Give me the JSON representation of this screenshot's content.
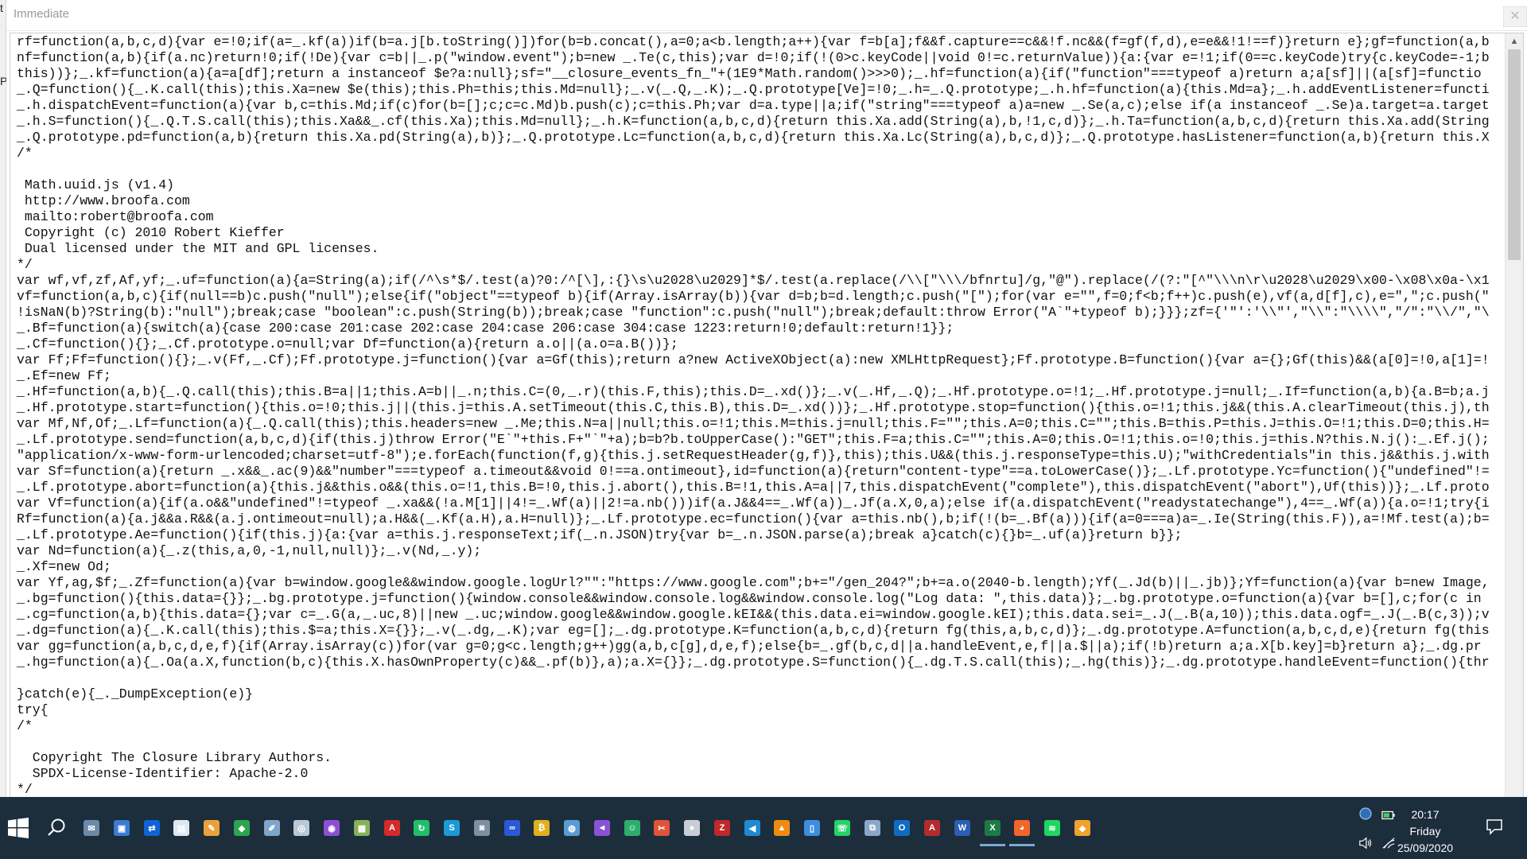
{
  "window": {
    "title": "Immediate",
    "close_glyph": "✕"
  },
  "left_sliver": {
    "glyphs": [
      "t",
      "P"
    ]
  },
  "code_lines": [
    "rf=function(a,b,c,d){var e=!0;if(a=_.kf(a))if(b=a.j[b.toString()])for(b=b.concat(),a=0;a<b.length;a++){var f=b[a];f&&f.capture==c&&!f.nc&&(f=gf(f,d),e=e&&!1!==f)}return e};gf=function(a,b",
    "nf=function(a,b){if(a.nc)return!0;if(!De){var c=b||_.p(\"window.event\");b=new _.Te(c,this);var d=!0;if(!(0>c.keyCode||void 0!=c.returnValue)){a:{var e=!1;if(0==c.keyCode)try{c.keyCode=-1;b",
    "this))};_.kf=function(a){a=a[df];return a instanceof $e?a:null};sf=\"__closure_events_fn_\"+(1E9*Math.random()>>>0);_.hf=function(a){if(\"function\"===typeof a)return a;a[sf]||(a[sf]=functio",
    "_.Q=function(){_.K.call(this);this.Xa=new $e(this);this.Ph=this;this.Md=null};_.v(_.Q,_.K);_.Q.prototype[Ve]=!0;_.h=_.Q.prototype;_.h.hf=function(a){this.Md=a};_.h.addEventListener=functi",
    "_.h.dispatchEvent=function(a){var b,c=this.Md;if(c)for(b=[];c;c=c.Md)b.push(c);c=this.Ph;var d=a.type||a;if(\"string\"===typeof a)a=new _.Se(a,c);else if(a instanceof _.Se)a.target=a.target",
    "_.h.S=function(){_.Q.T.S.call(this);this.Xa&&_.cf(this.Xa);this.Md=null};_.h.K=function(a,b,c,d){return this.Xa.add(String(a),b,!1,c,d)};_.h.Ta=function(a,b,c,d){return this.Xa.add(String",
    "_.Q.prototype.pd=function(a,b){return this.Xa.pd(String(a),b)};_.Q.prototype.Lc=function(a,b,c,d){return this.Xa.Lc(String(a),b,c,d)};_.Q.prototype.hasListener=function(a,b){return this.X",
    "/*",
    "",
    " Math.uuid.js (v1.4)",
    " http://www.broofa.com",
    " mailto:robert@broofa.com",
    " Copyright (c) 2010 Robert Kieffer",
    " Dual licensed under the MIT and GPL licenses.",
    "*/",
    "var wf,vf,zf,Af,yf;_.uf=function(a){a=String(a);if(/^\\s*$/.test(a)?0:/^[\\],:{}\\s\\u2028\\u2029]*$/.test(a.replace(/\\\\[\"\\\\\\/bfnrtu]/g,\"@\").replace(/(?:\"[^\"\\\\\\n\\r\\u2028\\u2029\\x00-\\x08\\x0a-\\x1",
    "vf=function(a,b,c){if(null==b)c.push(\"null\");else{if(\"object\"==typeof b){if(Array.isArray(b)){var d=b;b=d.length;c.push(\"[\");for(var e=\"\",f=0;f<b;f++)c.push(e),vf(a,d[f],c),e=\",\";c.push(\"",
    "!isNaN(b)?String(b):\"null\");break;case \"boolean\":c.push(String(b));break;case \"function\":c.push(\"null\");break;default:throw Error(\"A`\"+typeof b);}}};zf={'\"':'\\\\\"',\"\\\\\":\"\\\\\\\\\",\"/\":\"\\\\/\",\"\\",
    "_.Bf=function(a){switch(a){case 200:case 201:case 202:case 204:case 206:case 304:case 1223:return!0;default:return!1}};",
    "_.Cf=function(){};_.Cf.prototype.o=null;var Df=function(a){return a.o||(a.o=a.B())};",
    "var Ff;Ff=function(){};_.v(Ff,_.Cf);Ff.prototype.j=function(){var a=Gf(this);return a?new ActiveXObject(a):new XMLHttpRequest};Ff.prototype.B=function(){var a={};Gf(this)&&(a[0]=!0,a[1]=!",
    "_.Ef=new Ff;",
    "_.Hf=function(a,b){_.Q.call(this);this.B=a||1;this.A=b||_.n;this.C=(0,_.r)(this.F,this);this.D=_.xd()};_.v(_.Hf,_.Q);_.Hf.prototype.o=!1;_.Hf.prototype.j=null;_.If=function(a,b){a.B=b;a.j",
    "_.Hf.prototype.start=function(){this.o=!0;this.j||(this.j=this.A.setTimeout(this.C,this.B),this.D=_.xd())};_.Hf.prototype.stop=function(){this.o=!1;this.j&&(this.A.clearTimeout(this.j),th",
    "var Mf,Nf,Of;_.Lf=function(a){_.Q.call(this);this.headers=new _.Me;this.N=a||null;this.o=!1;this.M=this.j=null;this.F=\"\";this.A=0;this.C=\"\";this.B=this.P=this.J=this.O=!1;this.D=0;this.H=",
    "_.Lf.prototype.send=function(a,b,c,d){if(this.j)throw Error(\"E`\"+this.F+\"`\"+a);b=b?b.toUpperCase():\"GET\";this.F=a;this.C=\"\";this.A=0;this.O=!1;this.o=!0;this.j=this.N?this.N.j():_.Ef.j();",
    "\"application/x-www-form-urlencoded;charset=utf-8\");e.forEach(function(f,g){this.j.setRequestHeader(g,f)},this);this.U&&(this.j.responseType=this.U);\"withCredentials\"in this.j&&this.j.with",
    "var Sf=function(a){return _.x&&_.ac(9)&&\"number\"===typeof a.timeout&&void 0!==a.ontimeout},id=function(a){return\"content-type\"==a.toLowerCase()};_.Lf.prototype.Yc=function(){\"undefined\"!=",
    "_.Lf.prototype.abort=function(a){this.j&&this.o&&(this.o=!1,this.B=!0,this.j.abort(),this.B=!1,this.A=a||7,this.dispatchEvent(\"complete\"),this.dispatchEvent(\"abort\"),Uf(this))};_.Lf.proto",
    "var Vf=function(a){if(a.o&&\"undefined\"!=typeof _.xa&&(!a.M[1]||4!=_.Wf(a)||2!=a.nb()))if(a.J&&4==_.Wf(a))_.Jf(a.X,0,a);else if(a.dispatchEvent(\"readystatechange\"),4==_.Wf(a)){a.o=!1;try{i",
    "Rf=function(a){a.j&&a.R&&(a.j.ontimeout=null);a.H&&(_.Kf(a.H),a.H=null)};_.Lf.prototype.ec=function(){var a=this.nb(),b;if(!(b=_.Bf(a))){if(a=0===a)a=_.Ie(String(this.F)),a=!Mf.test(a);b=",
    "_.Lf.prototype.Ae=function(){if(this.j){a:{var a=this.j.responseText;if(_.n.JSON)try{var b=_.n.JSON.parse(a);break a}catch(c){}b=_.uf(a)}return b}};",
    "var Nd=function(a){_.z(this,a,0,-1,null,null)};_.v(Nd,_.y);",
    "_.Xf=new Od;",
    "var Yf,ag,$f;_.Zf=function(a){var b=window.google&&window.google.logUrl?\"\":\"https://www.google.com\";b+=\"/gen_204?\";b+=a.o(2040-b.length);Yf(_.Jd(b)||_.jb)};Yf=function(a){var b=new Image,",
    "_.bg=function(){this.data={}};_.bg.prototype.j=function(){window.console&&window.console.log&&window.console.log(\"Log data: \",this.data)};_.bg.prototype.o=function(a){var b=[],c;for(c in",
    "_.cg=function(a,b){this.data={};var c=_.G(a,_.uc,8)||new _.uc;window.google&&window.google.kEI&&(this.data.ei=window.google.kEI);this.data.sei=_.J(_.B(a,10));this.data.ogf=_.J(_.B(c,3));v",
    "_.dg=function(a){_.K.call(this);this.$=a;this.X={}};_.v(_.dg,_.K);var eg=[];_.dg.prototype.K=function(a,b,c,d){return fg(this,a,b,c,d)};_.dg.prototype.A=function(a,b,c,d,e){return fg(this",
    "var gg=function(a,b,c,d,e,f){if(Array.isArray(c))for(var g=0;g<c.length;g++)gg(a,b,c[g],d,e,f);else{b=_.gf(b,c,d||a.handleEvent,e,f||a.$||a);if(!b)return a;a.X[b.key]=b}return a};_.dg.pr",
    "_.hg=function(a){_.Oa(a.X,function(b,c){this.X.hasOwnProperty(c)&&_.pf(b)},a);a.X={}};_.dg.prototype.S=function(){_.dg.T.S.call(this);_.hg(this)};_.dg.prototype.handleEvent=function(){thr",
    "",
    "}catch(e){_._DumpException(e)}",
    "try{",
    "/*",
    "",
    "  Copyright The Closure Library Authors.",
    "  SPDX-License-Identifier: Apache-2.0",
    "*/"
  ],
  "scrollbar": {
    "up_glyph": "▲"
  },
  "taskbar": {
    "apps": [
      {
        "name": "mail-app-icon",
        "letter": "✉",
        "color": "#6b8aa8"
      },
      {
        "name": "photos-app-icon",
        "letter": "▣",
        "color": "#3a7bd5"
      },
      {
        "name": "teamviewer-icon",
        "letter": "⇄",
        "color": "#0e63d6"
      },
      {
        "name": "file-explorer-app-icon",
        "letter": "▤",
        "color": "#dfe7f0"
      },
      {
        "name": "paint-app-icon",
        "letter": "✎",
        "color": "#e9a23b"
      },
      {
        "name": "green-app-icon",
        "letter": "◆",
        "color": "#2da44e"
      },
      {
        "name": "draw-app-icon",
        "letter": "✐",
        "color": "#7fa6c9"
      },
      {
        "name": "chart-app-icon",
        "letter": "◎",
        "color": "#b9c7d6"
      },
      {
        "name": "media-app-icon",
        "letter": "◉",
        "color": "#8c4fd6"
      },
      {
        "name": "notepad-app-icon",
        "letter": "▦",
        "color": "#86b05a"
      },
      {
        "name": "acrobat-app-icon",
        "letter": "A",
        "color": "#d42a2a"
      },
      {
        "name": "refresh-app-icon",
        "letter": "↻",
        "color": "#1fbf6a"
      },
      {
        "name": "skype-app-icon",
        "letter": "S",
        "color": "#1a9ad6"
      },
      {
        "name": "camera-app-icon",
        "letter": "◙",
        "color": "#7f8fa3"
      },
      {
        "name": "mouse-app-icon",
        "letter": "∞",
        "color": "#2b58d6"
      },
      {
        "name": "coin-app-icon",
        "letter": "₿",
        "color": "#e0b020"
      },
      {
        "name": "globe-app-icon",
        "letter": "◍",
        "color": "#5b9bd5"
      },
      {
        "name": "visual-studio-icon",
        "letter": "◄",
        "color": "#8a52d6"
      },
      {
        "name": "chat-app-icon",
        "letter": "☺",
        "color": "#2eae6e"
      },
      {
        "name": "draw-tool-icon",
        "letter": "✂",
        "color": "#e0533a"
      },
      {
        "name": "circle-flag-icon",
        "letter": "●",
        "color": "#c9ced6"
      },
      {
        "name": "filezilla-icon",
        "letter": "Z",
        "color": "#c0282a"
      },
      {
        "name": "vscode-icon",
        "letter": "◀",
        "color": "#1f8ad6"
      },
      {
        "name": "vlc-icon",
        "letter": "▲",
        "color": "#f08a13"
      },
      {
        "name": "document-app-icon",
        "letter": "▯",
        "color": "#3d8ee0"
      },
      {
        "name": "whatsapp-icon",
        "letter": "☏",
        "color": "#25d366"
      },
      {
        "name": "network-app-icon",
        "letter": "⧉",
        "color": "#8aa6c9"
      },
      {
        "name": "outlook-icon",
        "letter": "O",
        "color": "#0f6cc2"
      },
      {
        "name": "access-icon",
        "letter": "A",
        "color": "#b52b2b"
      },
      {
        "name": "word-icon",
        "letter": "W",
        "color": "#2b5fb3"
      },
      {
        "name": "excel-icon",
        "letter": "X",
        "color": "#1d7a45"
      },
      {
        "name": "firefox-icon",
        "letter": "◕",
        "color": "#f2662a"
      },
      {
        "name": "spotify-icon",
        "letter": "≋",
        "color": "#1ed760"
      },
      {
        "name": "git-app-icon",
        "letter": "◆",
        "color": "#f0a22a"
      }
    ],
    "active_apps": [
      "excel-icon",
      "firefox-icon"
    ],
    "clock": {
      "time": "20:17",
      "day": "Friday",
      "date": "25/09/2020"
    }
  }
}
